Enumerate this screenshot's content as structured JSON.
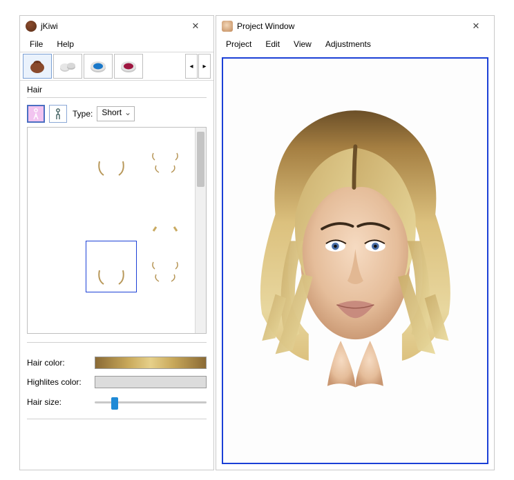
{
  "app": {
    "title": "jKiwi",
    "menu": {
      "file": "File",
      "help": "Help"
    }
  },
  "toolbar": {
    "tabs": [
      {
        "id": "hair",
        "name": "hair-tab-icon"
      },
      {
        "id": "base",
        "name": "base-tab-icon"
      },
      {
        "id": "eyeshadow",
        "name": "eyeshadow-tab-icon"
      },
      {
        "id": "lipstick",
        "name": "lipstick-tab-icon"
      }
    ],
    "nav_prev": "◂",
    "nav_next": "▸"
  },
  "panel": {
    "title": "Hair",
    "type_label": "Type:",
    "type_value": "Short",
    "gender_active": "female",
    "hair_styles_count": 12,
    "selected_index": 7
  },
  "fields": {
    "hair_color_label": "Hair color:",
    "highlites_label": "Highlites color:",
    "hair_size_label": "Hair size:",
    "hair_size_value": 15
  },
  "project": {
    "title": "Project Window",
    "menu": {
      "project": "Project",
      "edit": "Edit",
      "view": "View",
      "adjustments": "Adjustments"
    }
  },
  "colors": {
    "selection_border": "#1a3fd6",
    "hair_blonde_mid": "#c9a95b"
  }
}
